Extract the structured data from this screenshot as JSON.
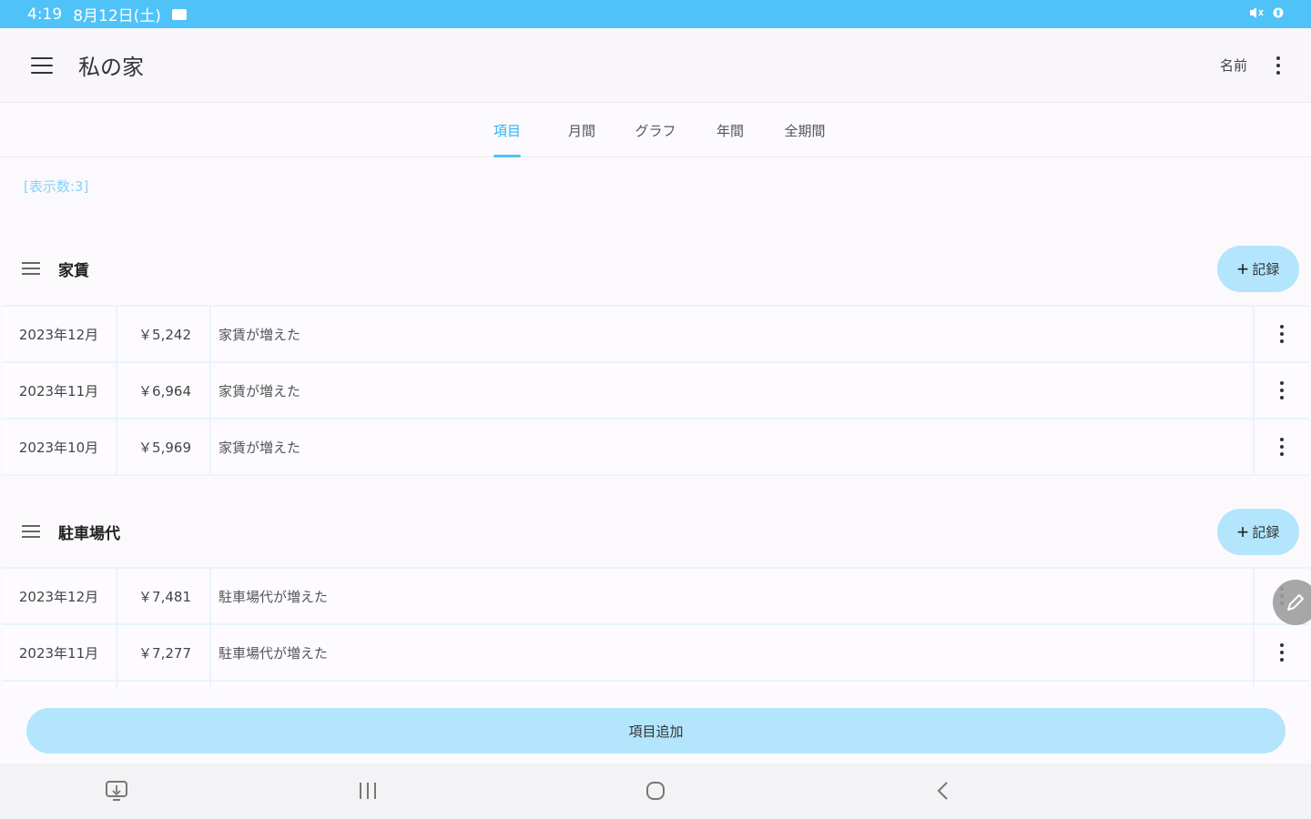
{
  "status_bar": {
    "time": "4:19",
    "date": "8月12日(土)",
    "icons": [
      "gallery-icon",
      "mute-icon",
      "battery-icon"
    ]
  },
  "app_bar": {
    "title": "私の家",
    "sort_label": "名前",
    "menu_icon": "hamburger-icon",
    "overflow_icon": "more-vert-icon"
  },
  "tabs": [
    {
      "label": "項目",
      "active": true
    },
    {
      "label": "月間",
      "active": false
    },
    {
      "label": "グラフ",
      "active": false
    },
    {
      "label": "年間",
      "active": false
    },
    {
      "label": "全期間",
      "active": false
    }
  ],
  "count_label": "[表示数:3]",
  "sections": [
    {
      "title": "家賃",
      "record_button": "記録",
      "rows": [
        {
          "date": "2023年12月",
          "amount": "￥5,242",
          "memo": "家賃が増えた"
        },
        {
          "date": "2023年11月",
          "amount": "￥6,964",
          "memo": "家賃が増えた"
        },
        {
          "date": "2023年10月",
          "amount": "￥5,969",
          "memo": "家賃が増えた"
        }
      ]
    },
    {
      "title": "駐車場代",
      "record_button": "記録",
      "rows": [
        {
          "date": "2023年12月",
          "amount": "￥7,481",
          "memo": "駐車場代が増えた"
        },
        {
          "date": "2023年11月",
          "amount": "￥7,277",
          "memo": "駐車場代が増えた"
        }
      ]
    }
  ],
  "add_item_button": "項目追加",
  "colors": {
    "accent": "#4fc3f7",
    "button_bg": "#b3e5fc",
    "grid_line": "#e8f4fd",
    "count_text": "#81d4fa"
  },
  "nav_bar": {
    "icons": [
      "screenshot-icon",
      "recents-icon",
      "home-icon",
      "back-icon"
    ]
  }
}
